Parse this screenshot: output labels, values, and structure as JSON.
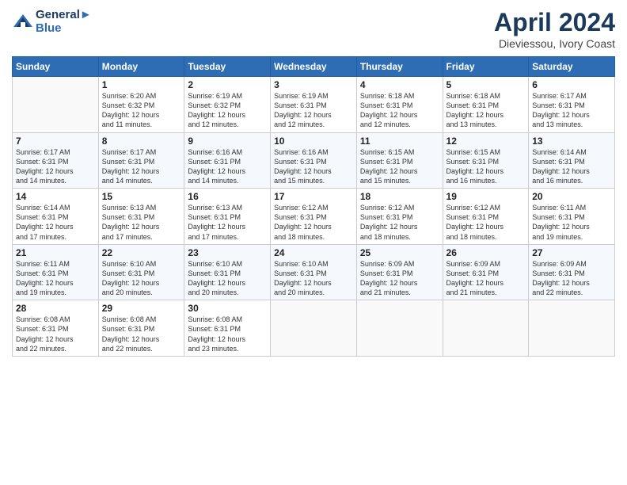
{
  "header": {
    "logo_line1": "General",
    "logo_line2": "Blue",
    "month": "April 2024",
    "location": "Dieviessou, Ivory Coast"
  },
  "weekdays": [
    "Sunday",
    "Monday",
    "Tuesday",
    "Wednesday",
    "Thursday",
    "Friday",
    "Saturday"
  ],
  "weeks": [
    [
      {
        "day": "",
        "info": ""
      },
      {
        "day": "1",
        "info": "Sunrise: 6:20 AM\nSunset: 6:32 PM\nDaylight: 12 hours\nand 11 minutes."
      },
      {
        "day": "2",
        "info": "Sunrise: 6:19 AM\nSunset: 6:32 PM\nDaylight: 12 hours\nand 12 minutes."
      },
      {
        "day": "3",
        "info": "Sunrise: 6:19 AM\nSunset: 6:31 PM\nDaylight: 12 hours\nand 12 minutes."
      },
      {
        "day": "4",
        "info": "Sunrise: 6:18 AM\nSunset: 6:31 PM\nDaylight: 12 hours\nand 12 minutes."
      },
      {
        "day": "5",
        "info": "Sunrise: 6:18 AM\nSunset: 6:31 PM\nDaylight: 12 hours\nand 13 minutes."
      },
      {
        "day": "6",
        "info": "Sunrise: 6:17 AM\nSunset: 6:31 PM\nDaylight: 12 hours\nand 13 minutes."
      }
    ],
    [
      {
        "day": "7",
        "info": "Sunrise: 6:17 AM\nSunset: 6:31 PM\nDaylight: 12 hours\nand 14 minutes."
      },
      {
        "day": "8",
        "info": "Sunrise: 6:17 AM\nSunset: 6:31 PM\nDaylight: 12 hours\nand 14 minutes."
      },
      {
        "day": "9",
        "info": "Sunrise: 6:16 AM\nSunset: 6:31 PM\nDaylight: 12 hours\nand 14 minutes."
      },
      {
        "day": "10",
        "info": "Sunrise: 6:16 AM\nSunset: 6:31 PM\nDaylight: 12 hours\nand 15 minutes."
      },
      {
        "day": "11",
        "info": "Sunrise: 6:15 AM\nSunset: 6:31 PM\nDaylight: 12 hours\nand 15 minutes."
      },
      {
        "day": "12",
        "info": "Sunrise: 6:15 AM\nSunset: 6:31 PM\nDaylight: 12 hours\nand 16 minutes."
      },
      {
        "day": "13",
        "info": "Sunrise: 6:14 AM\nSunset: 6:31 PM\nDaylight: 12 hours\nand 16 minutes."
      }
    ],
    [
      {
        "day": "14",
        "info": "Sunrise: 6:14 AM\nSunset: 6:31 PM\nDaylight: 12 hours\nand 17 minutes."
      },
      {
        "day": "15",
        "info": "Sunrise: 6:13 AM\nSunset: 6:31 PM\nDaylight: 12 hours\nand 17 minutes."
      },
      {
        "day": "16",
        "info": "Sunrise: 6:13 AM\nSunset: 6:31 PM\nDaylight: 12 hours\nand 17 minutes."
      },
      {
        "day": "17",
        "info": "Sunrise: 6:12 AM\nSunset: 6:31 PM\nDaylight: 12 hours\nand 18 minutes."
      },
      {
        "day": "18",
        "info": "Sunrise: 6:12 AM\nSunset: 6:31 PM\nDaylight: 12 hours\nand 18 minutes."
      },
      {
        "day": "19",
        "info": "Sunrise: 6:12 AM\nSunset: 6:31 PM\nDaylight: 12 hours\nand 18 minutes."
      },
      {
        "day": "20",
        "info": "Sunrise: 6:11 AM\nSunset: 6:31 PM\nDaylight: 12 hours\nand 19 minutes."
      }
    ],
    [
      {
        "day": "21",
        "info": "Sunrise: 6:11 AM\nSunset: 6:31 PM\nDaylight: 12 hours\nand 19 minutes."
      },
      {
        "day": "22",
        "info": "Sunrise: 6:10 AM\nSunset: 6:31 PM\nDaylight: 12 hours\nand 20 minutes."
      },
      {
        "day": "23",
        "info": "Sunrise: 6:10 AM\nSunset: 6:31 PM\nDaylight: 12 hours\nand 20 minutes."
      },
      {
        "day": "24",
        "info": "Sunrise: 6:10 AM\nSunset: 6:31 PM\nDaylight: 12 hours\nand 20 minutes."
      },
      {
        "day": "25",
        "info": "Sunrise: 6:09 AM\nSunset: 6:31 PM\nDaylight: 12 hours\nand 21 minutes."
      },
      {
        "day": "26",
        "info": "Sunrise: 6:09 AM\nSunset: 6:31 PM\nDaylight: 12 hours\nand 21 minutes."
      },
      {
        "day": "27",
        "info": "Sunrise: 6:09 AM\nSunset: 6:31 PM\nDaylight: 12 hours\nand 22 minutes."
      }
    ],
    [
      {
        "day": "28",
        "info": "Sunrise: 6:08 AM\nSunset: 6:31 PM\nDaylight: 12 hours\nand 22 minutes."
      },
      {
        "day": "29",
        "info": "Sunrise: 6:08 AM\nSunset: 6:31 PM\nDaylight: 12 hours\nand 22 minutes."
      },
      {
        "day": "30",
        "info": "Sunrise: 6:08 AM\nSunset: 6:31 PM\nDaylight: 12 hours\nand 23 minutes."
      },
      {
        "day": "",
        "info": ""
      },
      {
        "day": "",
        "info": ""
      },
      {
        "day": "",
        "info": ""
      },
      {
        "day": "",
        "info": ""
      }
    ]
  ]
}
